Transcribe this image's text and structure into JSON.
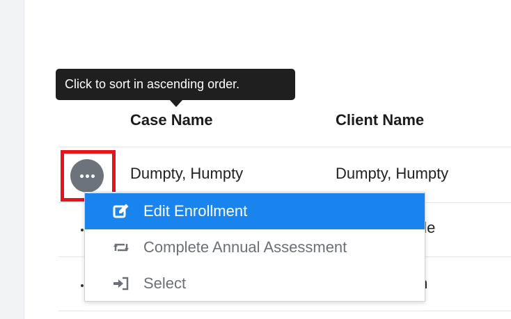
{
  "tooltip": {
    "text": "Click to sort in ascending order."
  },
  "table": {
    "headers": {
      "case_name": "Case Name",
      "client_name": "Client Name"
    },
    "rows": [
      {
        "case_name": "Dumpty, Humpty",
        "client_name": "Dumpty, Humpty"
      },
      {
        "client_name_visible": "ttle"
      },
      {
        "client_name_visible": "m"
      }
    ]
  },
  "actions_button": {
    "icon": "ellipsis-icon"
  },
  "context_menu": {
    "items": [
      {
        "label": "Edit Enrollment",
        "icon": "edit-icon",
        "active": true
      },
      {
        "label": "Complete Annual Assessment",
        "icon": "retweet-icon",
        "active": false
      },
      {
        "label": "Select",
        "icon": "sign-in-icon",
        "active": false
      }
    ]
  },
  "colors": {
    "menu_active_bg": "#1a84ee",
    "highlight_border": "#e8121b",
    "tooltip_bg": "#1f1f1f",
    "actions_button_bg": "#6d737b"
  }
}
